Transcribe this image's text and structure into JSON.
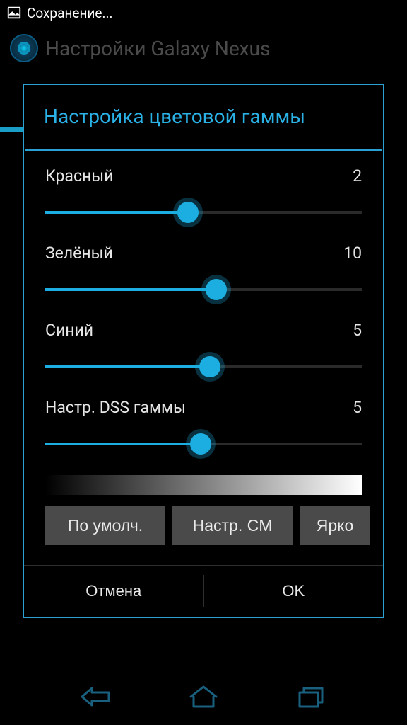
{
  "status": {
    "saving_text": "Сохранение..."
  },
  "header": {
    "title": "Настройки Galaxy Nexus"
  },
  "dialog": {
    "title": "Настройка цветовой гаммы",
    "sliders": [
      {
        "label": "Красный",
        "value": "2",
        "percent": 45
      },
      {
        "label": "Зелёный",
        "value": "10",
        "percent": 54
      },
      {
        "label": "Синий",
        "value": "5",
        "percent": 52
      },
      {
        "label": "Настр. DSS гаммы",
        "value": "5",
        "percent": 49
      }
    ],
    "presets": [
      "По умолч.",
      "Настр. CM",
      "Ярко"
    ],
    "cancel": "Отмена",
    "ok": "OK"
  }
}
